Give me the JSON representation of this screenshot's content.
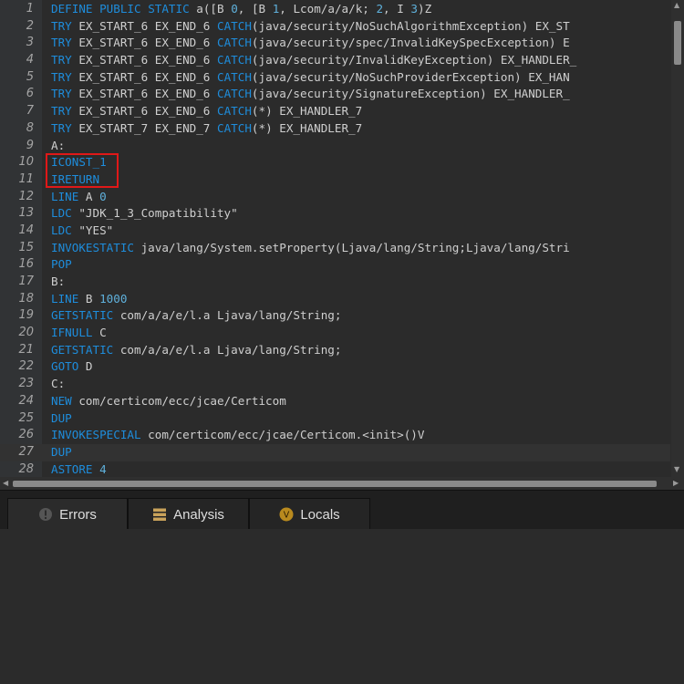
{
  "editor": {
    "lines": [
      {
        "num": "1",
        "tokens": [
          {
            "t": "DEFINE",
            "c": "kw"
          },
          {
            "t": " "
          },
          {
            "t": "PUBLIC",
            "c": "kw"
          },
          {
            "t": " "
          },
          {
            "t": "STATIC",
            "c": "kw"
          },
          {
            "t": " a([B "
          },
          {
            "t": "0",
            "c": "nm"
          },
          {
            "t": ", [B "
          },
          {
            "t": "1",
            "c": "nm"
          },
          {
            "t": ", Lcom/a/a/k; "
          },
          {
            "t": "2",
            "c": "nm"
          },
          {
            "t": ", I "
          },
          {
            "t": "3",
            "c": "nm"
          },
          {
            "t": ")Z"
          }
        ]
      },
      {
        "num": "2",
        "tokens": [
          {
            "t": "TRY",
            "c": "kw"
          },
          {
            "t": " EX_START_6 EX_END_6 "
          },
          {
            "t": "CATCH",
            "c": "kw"
          },
          {
            "t": "(java/security/NoSuchAlgorithmException) EX_ST"
          }
        ]
      },
      {
        "num": "3",
        "tokens": [
          {
            "t": "TRY",
            "c": "kw"
          },
          {
            "t": " EX_START_6 EX_END_6 "
          },
          {
            "t": "CATCH",
            "c": "kw"
          },
          {
            "t": "(java/security/spec/InvalidKeySpecException) E"
          }
        ]
      },
      {
        "num": "4",
        "tokens": [
          {
            "t": "TRY",
            "c": "kw"
          },
          {
            "t": " EX_START_6 EX_END_6 "
          },
          {
            "t": "CATCH",
            "c": "kw"
          },
          {
            "t": "(java/security/InvalidKeyException) EX_HANDLER_"
          }
        ]
      },
      {
        "num": "5",
        "tokens": [
          {
            "t": "TRY",
            "c": "kw"
          },
          {
            "t": " EX_START_6 EX_END_6 "
          },
          {
            "t": "CATCH",
            "c": "kw"
          },
          {
            "t": "(java/security/NoSuchProviderException) EX_HAN"
          }
        ]
      },
      {
        "num": "6",
        "tokens": [
          {
            "t": "TRY",
            "c": "kw"
          },
          {
            "t": " EX_START_6 EX_END_6 "
          },
          {
            "t": "CATCH",
            "c": "kw"
          },
          {
            "t": "(java/security/SignatureException) EX_HANDLER_"
          }
        ]
      },
      {
        "num": "7",
        "tokens": [
          {
            "t": "TRY",
            "c": "kw"
          },
          {
            "t": " EX_START_6 EX_END_6 "
          },
          {
            "t": "CATCH",
            "c": "kw"
          },
          {
            "t": "(*) EX_HANDLER_7"
          }
        ]
      },
      {
        "num": "8",
        "tokens": [
          {
            "t": "TRY",
            "c": "kw"
          },
          {
            "t": " EX_START_7 EX_END_7 "
          },
          {
            "t": "CATCH",
            "c": "kw"
          },
          {
            "t": "(*) EX_HANDLER_7"
          }
        ]
      },
      {
        "num": "9",
        "tokens": [
          {
            "t": "A:"
          }
        ]
      },
      {
        "num": "10",
        "tokens": [
          {
            "t": "ICONST_1",
            "c": "kw"
          }
        ]
      },
      {
        "num": "11",
        "tokens": [
          {
            "t": "IRETURN",
            "c": "kw"
          }
        ]
      },
      {
        "num": "12",
        "tokens": [
          {
            "t": "LINE",
            "c": "kw"
          },
          {
            "t": " A "
          },
          {
            "t": "0",
            "c": "nm"
          }
        ]
      },
      {
        "num": "13",
        "tokens": [
          {
            "t": "LDC",
            "c": "kw"
          },
          {
            "t": " \"JDK_1_3_Compatibility\""
          }
        ]
      },
      {
        "num": "14",
        "tokens": [
          {
            "t": "LDC",
            "c": "kw"
          },
          {
            "t": " \"YES\""
          }
        ]
      },
      {
        "num": "15",
        "tokens": [
          {
            "t": "INVOKESTATIC",
            "c": "kw"
          },
          {
            "t": " java/lang/System.setProperty(Ljava/lang/String;Ljava/lang/Stri"
          }
        ]
      },
      {
        "num": "16",
        "tokens": [
          {
            "t": "POP",
            "c": "kw"
          }
        ]
      },
      {
        "num": "17",
        "tokens": [
          {
            "t": "B:"
          }
        ]
      },
      {
        "num": "18",
        "tokens": [
          {
            "t": "LINE",
            "c": "kw"
          },
          {
            "t": " B "
          },
          {
            "t": "1000",
            "c": "nm"
          }
        ]
      },
      {
        "num": "19",
        "tokens": [
          {
            "t": "GETSTATIC",
            "c": "kw"
          },
          {
            "t": " com/a/a/e/l.a Ljava/lang/String;"
          }
        ]
      },
      {
        "num": "20",
        "tokens": [
          {
            "t": "IFNULL",
            "c": "kw"
          },
          {
            "t": " C"
          }
        ]
      },
      {
        "num": "21",
        "tokens": [
          {
            "t": "GETSTATIC",
            "c": "kw"
          },
          {
            "t": " com/a/a/e/l.a Ljava/lang/String;"
          }
        ]
      },
      {
        "num": "22",
        "tokens": [
          {
            "t": "GOTO",
            "c": "kw"
          },
          {
            "t": " D"
          }
        ]
      },
      {
        "num": "23",
        "tokens": [
          {
            "t": "C:"
          }
        ]
      },
      {
        "num": "24",
        "tokens": [
          {
            "t": "NEW",
            "c": "kw"
          },
          {
            "t": " com/certicom/ecc/jcae/Certicom"
          }
        ]
      },
      {
        "num": "25",
        "tokens": [
          {
            "t": "DUP",
            "c": "kw"
          }
        ]
      },
      {
        "num": "26",
        "tokens": [
          {
            "t": "INVOKESPECIAL",
            "c": "kw"
          },
          {
            "t": " com/certicom/ecc/jcae/Certicom.<init>()V"
          }
        ]
      },
      {
        "num": "27",
        "tokens": [
          {
            "t": "DUP",
            "c": "kw"
          }
        ],
        "current": true
      },
      {
        "num": "28",
        "tokens": [
          {
            "t": "ASTORE",
            "c": "kw"
          },
          {
            "t": " "
          },
          {
            "t": "4",
            "c": "nm"
          }
        ]
      }
    ]
  },
  "tabs": [
    {
      "label": "Errors",
      "icon": "error-icon",
      "active": true
    },
    {
      "label": "Analysis",
      "icon": "analysis-icon",
      "active": false
    },
    {
      "label": "Locals",
      "icon": "locals-icon",
      "active": false,
      "glyph": "V"
    }
  ],
  "colors": {
    "keyword": "#1e8ddc",
    "number": "#5fb1dc",
    "text": "#cfcfcf",
    "highlight_box": "#e01818",
    "locals_badge": "#b98a1e"
  }
}
